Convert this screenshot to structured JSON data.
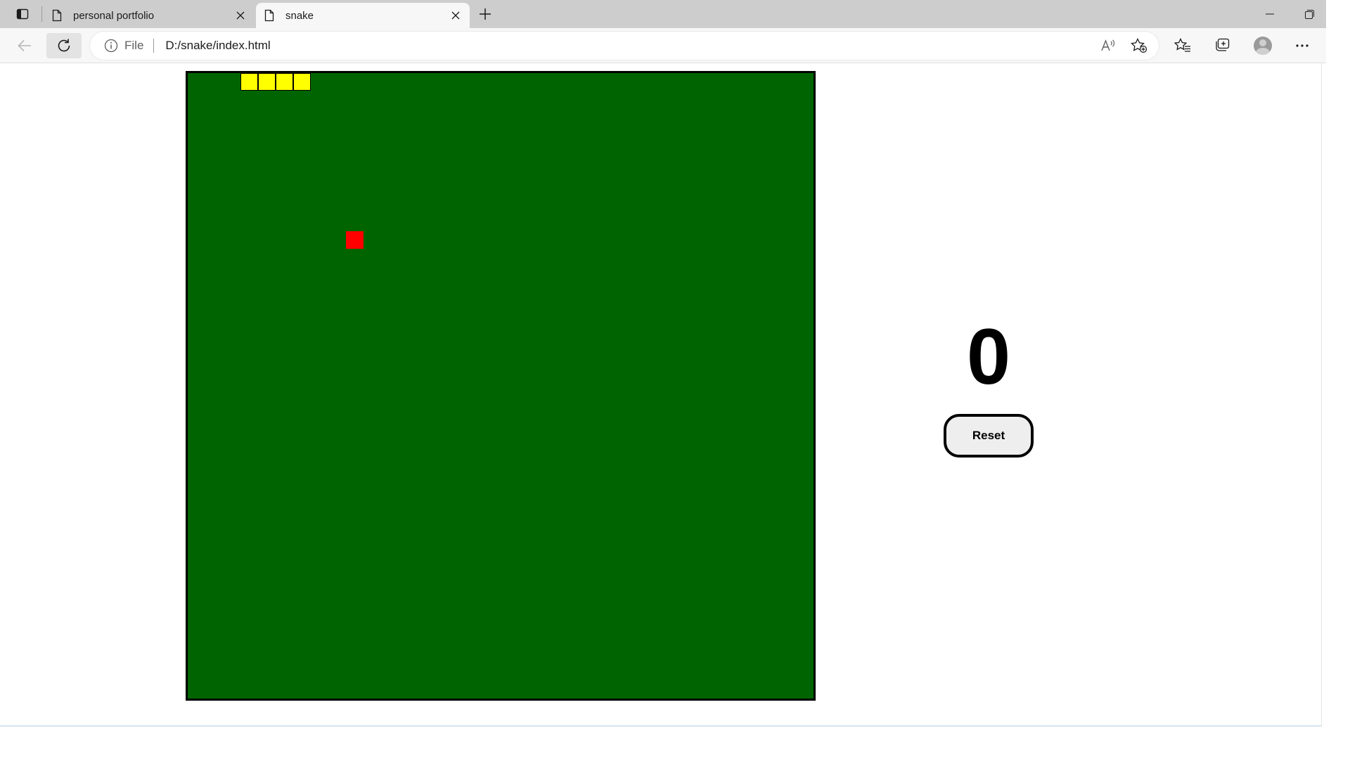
{
  "browser": {
    "tabs": [
      {
        "title": "personal portfolio",
        "active": false
      },
      {
        "title": "snake",
        "active": true
      }
    ],
    "address": {
      "site_info_label": "File",
      "url": "D:/snake/index.html"
    },
    "icons": {
      "tab_actions": "tab-actions-icon",
      "favicon": "page-icon",
      "close": "close-icon",
      "new_tab": "plus-icon",
      "back": "arrow-left-icon",
      "refresh": "refresh-icon",
      "info": "info-icon",
      "read_aloud": "read-aloud-icon",
      "add_favorite": "star-plus-icon",
      "favorites": "favorites-icon",
      "collections": "collections-icon",
      "profile": "avatar-icon",
      "more": "more-icon",
      "minimize": "minimize-icon",
      "restore": "restore-icon"
    }
  },
  "game": {
    "grid_size": 25,
    "colors": {
      "board": "#006400",
      "snake": "#ffff00",
      "snake_border": "#000000",
      "food": "#ff0000"
    },
    "snake": [
      {
        "col": 6,
        "row": 0
      },
      {
        "col": 5,
        "row": 0
      },
      {
        "col": 4,
        "row": 0
      },
      {
        "col": 3,
        "row": 0
      }
    ],
    "food": {
      "col": 9,
      "row": 9
    },
    "score": "0",
    "reset_label": "Reset"
  }
}
